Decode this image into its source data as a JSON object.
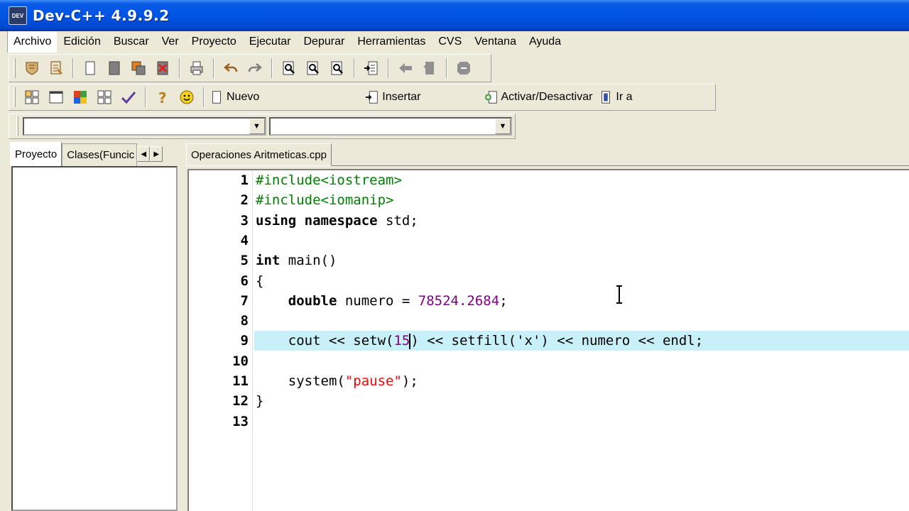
{
  "window": {
    "title": "Dev-C++ 4.9.9.2",
    "icon_text": "DEV"
  },
  "menu": [
    "Archivo",
    "Edición",
    "Buscar",
    "Ver",
    "Proyecto",
    "Ejecutar",
    "Depurar",
    "Herramientas",
    "CVS",
    "Ventana",
    "Ayuda"
  ],
  "toolbar2": {
    "nuevo": "Nuevo",
    "insertar": "Insertar",
    "activar": "Activar/Desactivar",
    "ir_a": "Ir a"
  },
  "left_tabs": [
    "Proyecto",
    "Clases(Funcic"
  ],
  "editor": {
    "tab": "Operaciones Aritmeticas.cpp",
    "current_line": 9,
    "lines": [
      {
        "n": "1",
        "parts": [
          [
            "pp",
            "#include<iostream>"
          ]
        ]
      },
      {
        "n": "2",
        "parts": [
          [
            "pp",
            "#include<iomanip>"
          ]
        ]
      },
      {
        "n": "3",
        "parts": [
          [
            "kw",
            "using"
          ],
          [
            "",
            " "
          ],
          [
            "kw",
            "namespace"
          ],
          [
            "",
            " std;"
          ]
        ]
      },
      {
        "n": "4",
        "parts": []
      },
      {
        "n": "5",
        "parts": [
          [
            "kw",
            "int"
          ],
          [
            "",
            " main()"
          ]
        ]
      },
      {
        "n": "6",
        "parts": [
          [
            "",
            "{"
          ]
        ]
      },
      {
        "n": "7",
        "parts": [
          [
            "",
            "    "
          ],
          [
            "kw",
            "double"
          ],
          [
            "",
            " numero = "
          ],
          [
            "num",
            "78524.2684"
          ],
          [
            "",
            ";"
          ]
        ]
      },
      {
        "n": "8",
        "parts": []
      },
      {
        "n": "9",
        "parts": [
          [
            "",
            "    cout << setw("
          ],
          [
            "num",
            "15"
          ],
          [
            "caret",
            ""
          ],
          [
            "",
            ") << setfill('x') << numero << endl;"
          ]
        ]
      },
      {
        "n": "10",
        "parts": []
      },
      {
        "n": "11",
        "parts": [
          [
            "",
            "    system("
          ],
          [
            "str",
            "\"pause\""
          ],
          [
            "",
            ");"
          ]
        ]
      },
      {
        "n": "12",
        "parts": [
          [
            "",
            "}"
          ]
        ]
      },
      {
        "n": "13",
        "parts": []
      }
    ]
  }
}
